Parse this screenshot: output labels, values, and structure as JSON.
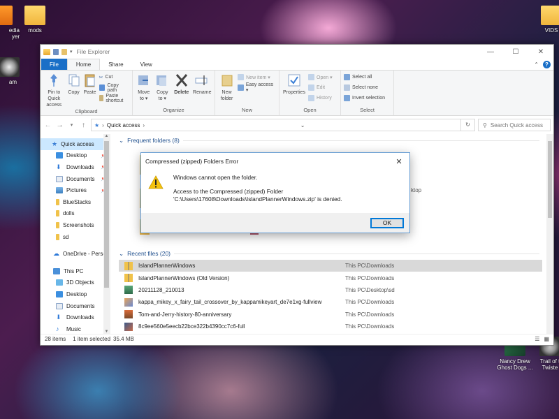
{
  "desktop": {
    "icons": [
      {
        "label": "edia\nyer"
      },
      {
        "label": "mods"
      },
      {
        "label": "am"
      },
      {
        "label": "VIDS"
      },
      {
        "label": "Nancy Drew\nGhost Dogs ..."
      },
      {
        "label": "Trail of t\nTwiste"
      }
    ]
  },
  "window": {
    "title": "File Explorer",
    "controls": {
      "minimize": "—",
      "maximize": "☐",
      "close": "✕"
    }
  },
  "ribbon_tabs": [
    "File",
    "Home",
    "Share",
    "View"
  ],
  "ribbon": {
    "clipboard": {
      "pin_to_quick_access": "Pin to Quick access",
      "copy": "Copy",
      "paste": "Paste",
      "cut": "Cut",
      "copy_path": "Copy path",
      "paste_shortcut": "Paste shortcut",
      "label": "Clipboard"
    },
    "organize": {
      "move_to": "Move to ▾",
      "copy_to": "Copy to ▾",
      "delete": "Delete",
      "rename": "Rename",
      "label": "Organize"
    },
    "new": {
      "new_folder": "New folder",
      "new_item": "New item ▾",
      "easy_access": "Easy access ▾",
      "label": "New"
    },
    "open": {
      "properties": "Properties",
      "open": "Open ▾",
      "edit": "Edit",
      "history": "History",
      "label": "Open"
    },
    "select": {
      "select_all": "Select all",
      "select_none": "Select none",
      "invert_selection": "Invert selection",
      "label": "Select"
    }
  },
  "address": {
    "breadcrumb_root": "Quick access",
    "breadcrumb_sep": "›",
    "search_placeholder": "Search Quick access"
  },
  "nav_pane": {
    "quick_access": "Quick access",
    "quick_items": [
      {
        "label": "Desktop",
        "pinned": true
      },
      {
        "label": "Downloads",
        "pinned": true
      },
      {
        "label": "Documents",
        "pinned": true
      },
      {
        "label": "Pictures",
        "pinned": true
      },
      {
        "label": "BlueStacks",
        "pinned": false
      },
      {
        "label": "dolls",
        "pinned": false
      },
      {
        "label": "Screenshots",
        "pinned": false
      },
      {
        "label": "sd",
        "pinned": false
      }
    ],
    "onedrive": "OneDrive - Person",
    "this_pc": "This PC",
    "pc_items": [
      "3D Objects",
      "Desktop",
      "Documents",
      "Downloads",
      "Music"
    ]
  },
  "content": {
    "frequent_header": "Frequent folders (8)",
    "frequent_partial_text": "ktop",
    "recent_header": "Recent files (20)",
    "recent_files": [
      {
        "name": "IslandPlannerWindows",
        "location": "This PC\\Downloads",
        "selected": true
      },
      {
        "name": "IslandPlannerWindows (Old Version)",
        "location": "This PC\\Downloads",
        "selected": false
      },
      {
        "name": "20211128_210013",
        "location": "This PC\\Desktop\\sd",
        "selected": false
      },
      {
        "name": "kappa_mikey_x_fairy_tail_crossover_by_kappamikeyart_de7e1xg-fullview",
        "location": "This PC\\Downloads",
        "selected": false
      },
      {
        "name": "Tom-and-Jerry-history-80-anniversary",
        "location": "This PC\\Downloads",
        "selected": false
      },
      {
        "name": "8c9ee560e5eecb22bce322b4390cc7c6-full",
        "location": "This PC\\Downloads",
        "selected": false
      }
    ]
  },
  "status": {
    "items": "28 items",
    "selected": "1 item selected",
    "size": "35.4 MB"
  },
  "dialog": {
    "title": "Compressed (zipped) Folders Error",
    "close": "✕",
    "main_message": "Windows cannot open the folder.",
    "detail_line1": "Access to the Compressed (zipped) Folder",
    "detail_line2": "'C:\\Users\\17608\\Downloads\\IslandPlannerWindows.zip' is denied.",
    "ok": "OK"
  },
  "colors": {
    "accent": "#1a6fc7",
    "selection": "#cce8ff",
    "warning": "#f4c20d"
  }
}
